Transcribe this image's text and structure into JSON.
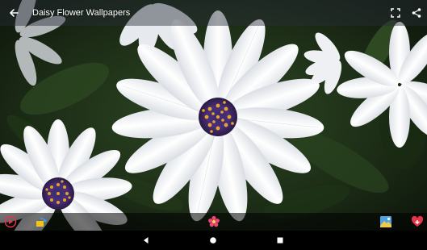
{
  "appbar": {
    "title": "Daisy Flower Wallpapers",
    "back_icon": "arrow-back-icon",
    "actions": [
      "fullscreen-icon",
      "share-icon"
    ]
  },
  "wallpaper": {
    "subject": "white-daisy-flowers-photo"
  },
  "toolbar": {
    "items": [
      "slideshow-icon",
      "rotate-icon",
      "flower-icon",
      "set-wallpaper-icon",
      "favorite-add-icon"
    ]
  },
  "navbar": {
    "items": [
      "nav-back-icon",
      "nav-home-icon",
      "nav-recents-icon"
    ]
  },
  "colors": {
    "appbar_bg": "#3a3f48",
    "toolbar_bg": "#000000",
    "accent_red": "#e8334a",
    "navbar_bg": "#000000"
  }
}
